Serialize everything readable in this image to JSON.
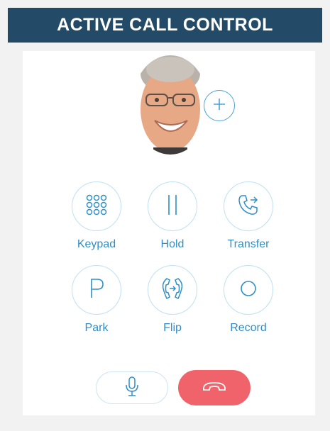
{
  "header": {
    "title": "ACTIVE CALL CONTROL"
  },
  "controls": [
    {
      "label": "Keypad",
      "icon": "keypad-icon"
    },
    {
      "label": "Hold",
      "icon": "pause-icon"
    },
    {
      "label": "Transfer",
      "icon": "phone-transfer-icon"
    },
    {
      "label": "Park",
      "icon": "park-p-icon"
    },
    {
      "label": "Flip",
      "icon": "phone-flip-icon"
    },
    {
      "label": "Record",
      "icon": "record-circle-icon"
    }
  ],
  "actions": {
    "add_icon": "plus-icon",
    "mute_icon": "microphone-icon",
    "hangup_icon": "hang-up-phone-icon"
  },
  "colors": {
    "header_bg": "#234b67",
    "accent": "#2f8fc6",
    "circle_border": "#bfe0f2",
    "hangup": "#f0636a"
  }
}
